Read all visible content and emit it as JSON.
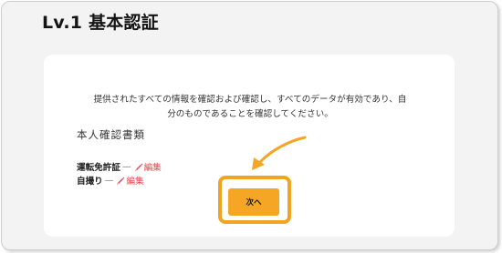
{
  "page": {
    "title": "Lv.1 基本認証"
  },
  "card": {
    "description_line1": "提供されたすべての情報を確認および確認し、すべてのデータが有効であり、自",
    "description_line2": "分のものであることを確認してください。",
    "section_title": "本人確認書類",
    "documents": [
      {
        "label": "運転免許証",
        "dash": "—",
        "edit_label": "編集"
      },
      {
        "label": "自撮り",
        "dash": "—",
        "edit_label": "編集"
      }
    ],
    "next_button": "次へ"
  },
  "colors": {
    "accent_orange": "#f4a624",
    "edit_red": "#e8424b"
  },
  "icons": {
    "edit": "pencil-icon",
    "hint": "curved-arrow-icon"
  }
}
